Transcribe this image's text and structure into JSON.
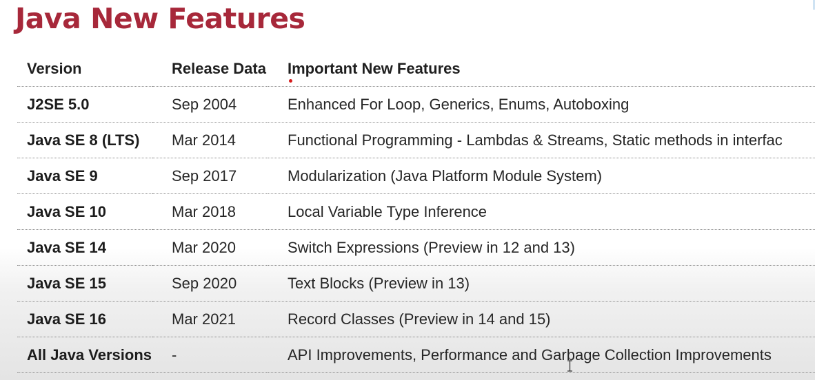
{
  "page": {
    "title": "Java New Features"
  },
  "table": {
    "headers": {
      "version": "Version",
      "release": "Release Data",
      "features": "Important New Features"
    },
    "rows": [
      {
        "version": "J2SE 5.0",
        "date": "Sep 2004",
        "features": "Enhanced For Loop, Generics, Enums, Autoboxing"
      },
      {
        "version": "Java SE 8 (LTS)",
        "date": "Mar 2014",
        "features": "Functional Programming - Lambdas & Streams, Static methods in interfac"
      },
      {
        "version": "Java SE 9",
        "date": "Sep 2017",
        "features": "Modularization (Java Platform Module System)"
      },
      {
        "version": "Java SE 10",
        "date": "Mar 2018",
        "features": "Local Variable Type Inference"
      },
      {
        "version": "Java SE 14",
        "date": "Mar 2020",
        "features": "Switch Expressions (Preview in 12 and 13)"
      },
      {
        "version": "Java SE 15",
        "date": "Sep 2020",
        "features": "Text Blocks (Preview in 13)"
      },
      {
        "version": "Java SE 16",
        "date": "Mar 2021",
        "features": "Record Classes (Preview in 14 and 15)"
      },
      {
        "version": "All Java Versions",
        "date": "-",
        "features": "API Improvements, Performance and Garbage Collection Improvements"
      }
    ]
  },
  "colors": {
    "title": "#a7283a",
    "pointer_dot": "#d51b1b"
  },
  "icons": {
    "pointer_dot": "red-pointer-dot",
    "cursor": "text-cursor-icon"
  }
}
